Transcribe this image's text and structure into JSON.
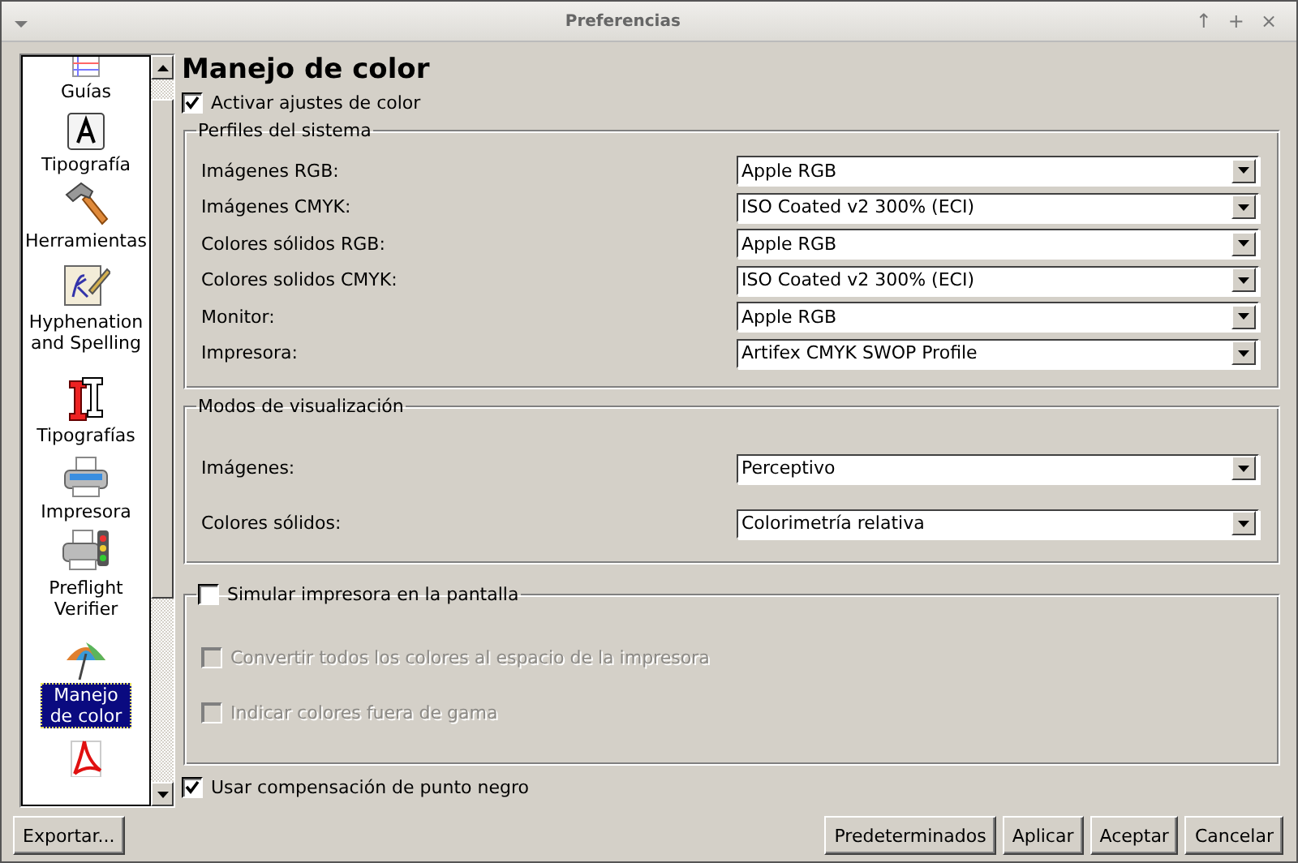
{
  "window": {
    "title": "Preferencias",
    "controls": [
      "↑",
      "+",
      "×"
    ]
  },
  "sidebar": {
    "items": [
      {
        "label": "Guías",
        "selected": false
      },
      {
        "label": "Tipografía",
        "selected": false
      },
      {
        "label": "Herramientas",
        "selected": false
      },
      {
        "label": "Hyphenation and Spelling",
        "selected": false
      },
      {
        "label": "Tipografías",
        "selected": false
      },
      {
        "label": "Impresora",
        "selected": false
      },
      {
        "label": "Preflight Verifier",
        "selected": false
      },
      {
        "label": "Manejo de color",
        "selected": true
      },
      {
        "selected": false
      }
    ]
  },
  "page_title": "Manejo de color",
  "enable_color": {
    "label": "Activar ajustes de color",
    "checked": true
  },
  "system_profiles": {
    "title": "Perfiles del sistema",
    "rows": [
      {
        "label": "Imágenes RGB:",
        "value": "Apple RGB"
      },
      {
        "label": "Imágenes CMYK:",
        "value": "ISO Coated v2 300% (ECI)"
      },
      {
        "label": "Colores sólidos RGB:",
        "value": "Apple RGB"
      },
      {
        "label": "Colores solidos CMYK:",
        "value": "ISO Coated v2 300% (ECI)"
      },
      {
        "label": "Monitor:",
        "value": "Apple RGB"
      },
      {
        "label": "Impresora:",
        "value": "Artifex CMYK SWOP Profile"
      }
    ]
  },
  "display_modes": {
    "title": "Modos de visualización",
    "rows": [
      {
        "label": "Imágenes:",
        "value": "Perceptivo"
      },
      {
        "label": "Colores sólidos:",
        "value": "Colorimetría relativa"
      }
    ]
  },
  "simulate": {
    "label": "Simular impresora en la pantalla",
    "checked": false,
    "options": [
      {
        "label": "Convertir todos los colores al espacio de la impresora",
        "checked": false,
        "disabled": true
      },
      {
        "label": "Indicar colores fuera de gama",
        "checked": false,
        "disabled": true
      }
    ]
  },
  "black_point": {
    "label": "Usar compensación de punto negro",
    "checked": true
  },
  "buttons": {
    "left": [
      "Exportar..."
    ],
    "right": [
      "Predeterminados",
      "Aplicar",
      "Aceptar",
      "Cancelar"
    ]
  }
}
